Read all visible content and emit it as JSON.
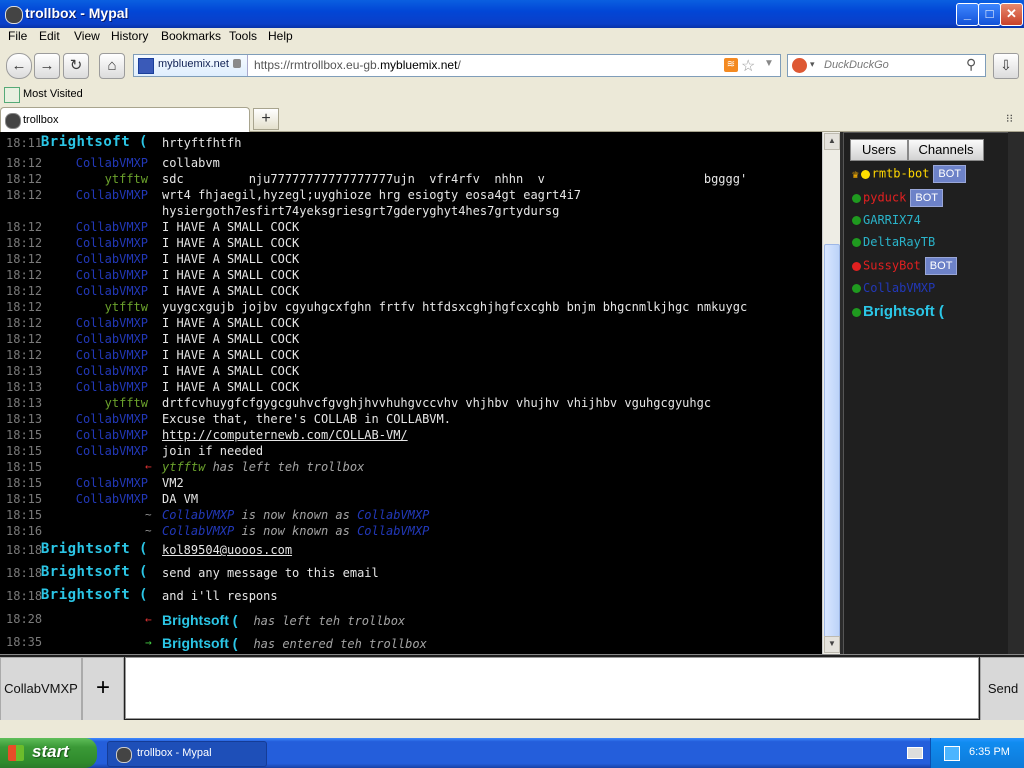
{
  "window": {
    "title": "trollbox - Mypal",
    "minimize": "_",
    "maximize": "□",
    "close": "✕"
  },
  "menu": [
    "File",
    "Edit",
    "View",
    "History",
    "Bookmarks",
    "Tools",
    "Help"
  ],
  "nav": {
    "back_icon": "back-arrow-icon",
    "forward_icon": "forward-arrow-icon",
    "reload_icon": "reload-icon",
    "home_icon": "home-icon",
    "identity_site": "mybluemix.net",
    "url_prefix": "https://rmtrollbox.eu-gb.",
    "url_domain": "mybluemix.net",
    "url_suffix": "/",
    "search_placeholder": "DuckDuckGo",
    "download_icon": "download-arrow-icon"
  },
  "bookmarks": {
    "most_visited": "Most Visited"
  },
  "tabs": [
    {
      "label": "trollbox"
    }
  ],
  "newtab_label": "+",
  "chat": {
    "rows": [
      {
        "time": "18:11",
        "nick": "Brightsoft (",
        "nick_style": "bright",
        "msg": "hrtyftfhtfh",
        "type": "msg"
      },
      {
        "time": "18:12",
        "nick": "CollabVMXP",
        "nick_style": "blue",
        "msg": "collabvm",
        "type": "msg"
      },
      {
        "time": "18:12",
        "nick": "ytfftw",
        "nick_style": "green",
        "msg": "sdc         nju77777777777777777ujn  vfr4rfv  nhhn  v                      bgggg'",
        "type": "msg"
      },
      {
        "time": "18:12",
        "nick": "CollabVMXP",
        "nick_style": "blue",
        "msg": "wrt4 fhjaegil,hyzegl;uyghioze hrg esiogty eosa4gt eagrt4i7",
        "type": "msg"
      },
      {
        "time": "",
        "nick": "",
        "nick_style": "blue",
        "msg": "hysiergoth7esfirt74yeksgriesgrt7gderyghyt4hes7grtydursg",
        "type": "msg"
      },
      {
        "time": "18:12",
        "nick": "CollabVMXP",
        "nick_style": "blue",
        "msg": "I HAVE A SMALL COCK",
        "type": "msg"
      },
      {
        "time": "18:12",
        "nick": "CollabVMXP",
        "nick_style": "blue",
        "msg": "I HAVE A SMALL COCK",
        "type": "msg"
      },
      {
        "time": "18:12",
        "nick": "CollabVMXP",
        "nick_style": "blue",
        "msg": "I HAVE A SMALL COCK",
        "type": "msg"
      },
      {
        "time": "18:12",
        "nick": "CollabVMXP",
        "nick_style": "blue",
        "msg": "I HAVE A SMALL COCK",
        "type": "msg"
      },
      {
        "time": "18:12",
        "nick": "CollabVMXP",
        "nick_style": "blue",
        "msg": "I HAVE A SMALL COCK",
        "type": "msg"
      },
      {
        "time": "18:12",
        "nick": "ytfftw",
        "nick_style": "green",
        "msg": "yuygcxgujb jojbv cgyuhgcxfghn frtfv htfdsxcghjhgfcxcghb bnjm bhgcnmlkjhgc nmkuygc",
        "type": "msg"
      },
      {
        "time": "18:12",
        "nick": "CollabVMXP",
        "nick_style": "blue",
        "msg": "I HAVE A SMALL COCK",
        "type": "msg"
      },
      {
        "time": "18:12",
        "nick": "CollabVMXP",
        "nick_style": "blue",
        "msg": "I HAVE A SMALL COCK",
        "type": "msg"
      },
      {
        "time": "18:12",
        "nick": "CollabVMXP",
        "nick_style": "blue",
        "msg": "I HAVE A SMALL COCK",
        "type": "msg"
      },
      {
        "time": "18:13",
        "nick": "CollabVMXP",
        "nick_style": "blue",
        "msg": "I HAVE A SMALL COCK",
        "type": "msg"
      },
      {
        "time": "18:13",
        "nick": "CollabVMXP",
        "nick_style": "blue",
        "msg": "I HAVE A SMALL COCK",
        "type": "msg"
      },
      {
        "time": "18:13",
        "nick": "ytfftw",
        "nick_style": "green",
        "msg": "drtfcvhuygfcfgygcguhvcfgvghjhvvhuhgvccvhv vhjhbv vhujhv vhijhbv vguhgcgyuhgc",
        "type": "msg"
      },
      {
        "time": "18:13",
        "nick": "CollabVMXP",
        "nick_style": "blue",
        "msg": "Excuse that, there's COLLAB in COLLABVM.",
        "type": "msg"
      },
      {
        "time": "18:15",
        "nick": "CollabVMXP",
        "nick_style": "blue",
        "msg": "http://computernewb.com/COLLAB-VM/",
        "type": "link"
      },
      {
        "time": "18:15",
        "nick": "CollabVMXP",
        "nick_style": "blue",
        "msg": "join if needed",
        "type": "msg"
      },
      {
        "time": "18:15",
        "nick": "",
        "arrow": "←",
        "arrow_color": "#d33",
        "who": "ytfftw",
        "who_style": "green",
        "msg": " has left teh trollbox",
        "type": "event"
      },
      {
        "time": "18:15",
        "nick": "CollabVMXP",
        "nick_style": "blue",
        "msg": "VM2",
        "type": "msg"
      },
      {
        "time": "18:15",
        "nick": "CollabVMXP",
        "nick_style": "blue",
        "msg": "DA VM",
        "type": "msg"
      },
      {
        "time": "18:15",
        "nick": "",
        "arrow": "~",
        "arrow_color": "#999",
        "who": "CollabVMXP",
        "who_style": "blue",
        "msg": " is now known as ",
        "who2": "CollabVMXP",
        "type": "event2"
      },
      {
        "time": "18:16",
        "nick": "",
        "arrow": "~",
        "arrow_color": "#999",
        "who": "CollabVMXP",
        "who_style": "blue",
        "msg": " is now known as ",
        "who2": "CollabVMXP",
        "type": "event2"
      },
      {
        "time": "18:18",
        "nick": "Brightsoft (",
        "nick_style": "bright",
        "msg": "kol89504@uooos.com",
        "type": "link"
      },
      {
        "time": "18:18",
        "nick": "Brightsoft (",
        "nick_style": "bright",
        "msg": "send any message to this email",
        "type": "msg"
      },
      {
        "time": "18:18",
        "nick": "Brightsoft (",
        "nick_style": "bright",
        "msg": "and i'll respons",
        "type": "msg"
      },
      {
        "time": "18:28",
        "nick": "",
        "arrow": "←",
        "arrow_color": "#d33",
        "who": "Brightsoft (",
        "who_style": "bright",
        "msg": "has left teh trollbox",
        "type": "bigevent"
      },
      {
        "time": "18:35",
        "nick": "",
        "arrow": "→",
        "arrow_color": "#4c4",
        "who": "Brightsoft (",
        "who_style": "bright",
        "msg": "has entered teh trollbox",
        "type": "bigevent"
      }
    ]
  },
  "sidebar": {
    "tab_users": "Users",
    "tab_channels": "Channels",
    "users": [
      {
        "name": "rmtb-bot",
        "color": "#ffd700",
        "dot": "#ffe000",
        "bot": true,
        "crown": true
      },
      {
        "name": "pyduck",
        "color": "#e12020",
        "dot": "#1f9a1f",
        "bot": true
      },
      {
        "name": "GARRIX74",
        "color": "#2ab3c9",
        "dot": "#1f9a1f",
        "bot": false
      },
      {
        "name": "DeltaRayTB",
        "color": "#2ab3c9",
        "dot": "#1f9a1f",
        "bot": false
      },
      {
        "name": "SussyBot",
        "color": "#e12020",
        "dot": "#e12020",
        "bot": true
      },
      {
        "name": "CollabVMXP",
        "color": "#2238b8",
        "dot": "#1f9a1f",
        "bot": false
      },
      {
        "name": "Brightsoft (",
        "color": "#2bc6e6",
        "dot": "#1f9a1f",
        "bot": false,
        "big": true
      }
    ],
    "bot_label": "BOT"
  },
  "input": {
    "nick_label": "CollabVMXP",
    "plus_label": "+",
    "send_label": "Send",
    "value": ""
  },
  "taskbar": {
    "start_label": "start",
    "task_label": "trollbox - Mypal",
    "clock": "6:35 PM"
  }
}
